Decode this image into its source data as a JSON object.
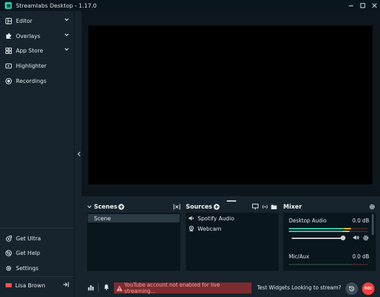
{
  "window": {
    "title": "Streamlabs Desktop - 1.17.0"
  },
  "sidebar": {
    "items": [
      {
        "label": "Editor",
        "icon": "layout-icon"
      },
      {
        "label": "Overlays",
        "icon": "puzzle-icon"
      },
      {
        "label": "App Store",
        "icon": "store-icon"
      },
      {
        "label": "Highlighter",
        "icon": "highlighter-icon"
      },
      {
        "label": "Recordings",
        "icon": "record-icon"
      }
    ],
    "bottom_items": [
      {
        "label": "Get Ultra",
        "icon": "ultra-icon"
      },
      {
        "label": "Get Help",
        "icon": "help-icon"
      },
      {
        "label": "Settings",
        "icon": "gear-icon"
      }
    ],
    "user": {
      "name": "Lisa Brown"
    }
  },
  "scenes": {
    "title": "Scenes",
    "items": [
      "Scene"
    ]
  },
  "sources": {
    "title": "Sources",
    "items": [
      {
        "label": "Spotify Audio",
        "icon": "speaker-icon"
      },
      {
        "label": "Webcam",
        "icon": "webcam-icon"
      }
    ]
  },
  "mixer": {
    "title": "Mixer",
    "channels": [
      {
        "name": "Desktop Audio",
        "db": "0.0 dB",
        "volume": 1.0
      },
      {
        "name": "Mic/Aux",
        "db": "0.0 dB"
      }
    ]
  },
  "footer": {
    "warning": "YouTube account not enabled for live streaming...",
    "test_widgets": "Test Widgets",
    "looking": "Looking to stream?",
    "rec_label": "REC"
  },
  "colors": {
    "accent": "#31c3a2",
    "background": "#17242d",
    "panel": "#09161d",
    "warning_bg": "#7c2c2f",
    "record": "#fc3e3e"
  }
}
